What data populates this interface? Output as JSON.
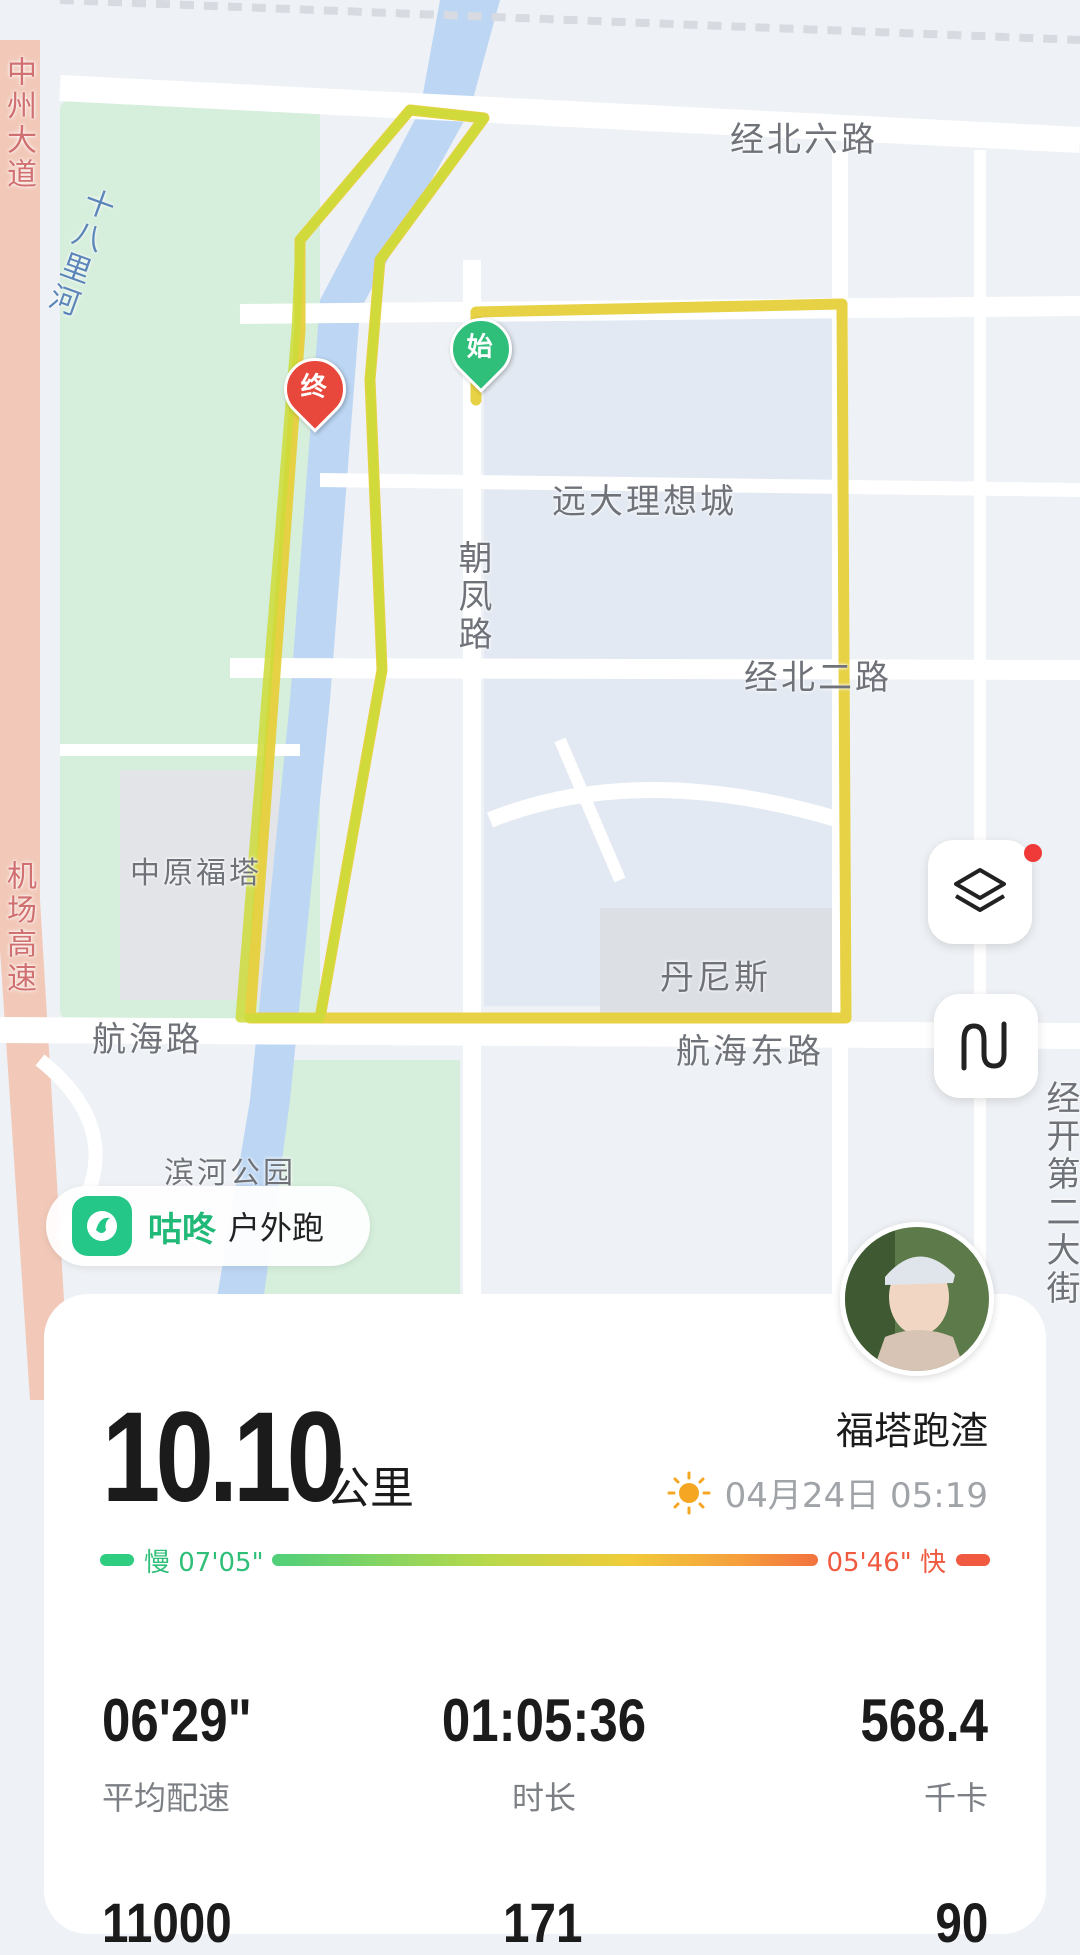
{
  "map": {
    "labels": {
      "road_jingbei6": "经北六路",
      "road_jingbei2": "经北二路",
      "road_hanghai": "航海路",
      "road_hanghai_east": "航海东路",
      "road_chaofeng": "朝凤路",
      "road_zhongzhou": "中州大道",
      "road_airport": "机场高速",
      "road_jingkai": "经开第二大街",
      "river_18li": "十八里河",
      "poi_yuanda": "远大理想城",
      "poi_zhongyuan": "中原福塔",
      "poi_danisi": "丹尼斯",
      "poi_park": "滨河公园"
    },
    "start_marker": "始",
    "end_marker": "终"
  },
  "brand": {
    "name": "咕咚",
    "mode": "户外跑"
  },
  "summary": {
    "distance": "10.10",
    "distance_unit": "公里",
    "user_name": "福塔跑渣",
    "date": "04月24日 05:19",
    "pace_slow": "慢 07'05\"",
    "pace_fast": "05'46\" 快"
  },
  "stats": [
    {
      "value": "06'29\"",
      "label": "平均配速"
    },
    {
      "value": "01:05:36",
      "label": "时长"
    },
    {
      "value": "568.4",
      "label": "千卡"
    }
  ],
  "stats_partial": [
    "11000",
    "171",
    "90"
  ],
  "colors": {
    "route": "#e6cf3a",
    "start": "#2fbf7a",
    "end": "#e8473b",
    "brand": "#24c788"
  }
}
